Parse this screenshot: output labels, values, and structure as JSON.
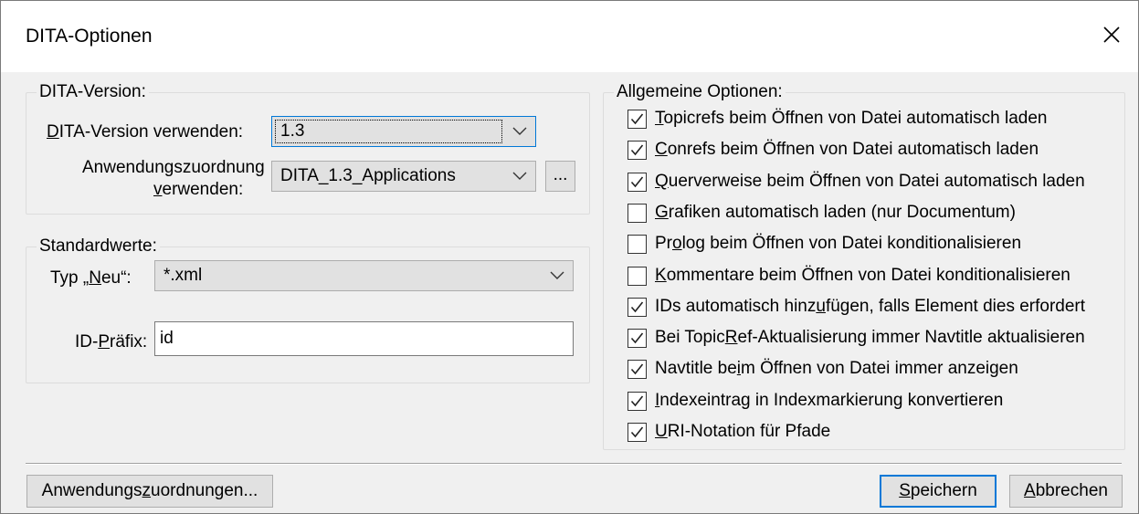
{
  "window": {
    "title": "DITA-Optionen"
  },
  "dita_version_group": {
    "legend": "DITA-Version:",
    "version_label": "DITA-Version verwenden:",
    "version_value": "1.3",
    "app_mapping_label_line1": "Anwendungszuordnung",
    "app_mapping_label_line2": "verwenden:",
    "app_mapping_value": "DITA_1.3_Applications",
    "browse_label": "..."
  },
  "defaults_group": {
    "legend": "Standardwerte:",
    "type_label": "Typ „Neu“:",
    "type_value": "*.xml",
    "id_prefix_label": "ID-Präfix:",
    "id_prefix_value": "id"
  },
  "general_options": {
    "legend": "Allgemeine Optionen:",
    "items": [
      {
        "label": "Topicrefs beim Öffnen von Datei automatisch laden",
        "checked": true
      },
      {
        "label": "Conrefs beim Öffnen von Datei automatisch laden",
        "checked": true
      },
      {
        "label": "Querverweise beim Öffnen von Datei automatisch laden",
        "checked": true
      },
      {
        "label": "Grafiken automatisch laden (nur Documentum)",
        "checked": false
      },
      {
        "label": "Prolog beim Öffnen von Datei konditionalisieren",
        "checked": false
      },
      {
        "label": "Kommentare beim Öffnen von Datei konditionalisieren",
        "checked": false
      },
      {
        "label": "IDs automatisch hinzufügen, falls Element dies erfordert",
        "checked": true
      },
      {
        "label": "Bei TopicRef-Aktualisierung immer Navtitle aktualisieren",
        "checked": true
      },
      {
        "label": "Navtitle beim Öffnen von Datei immer anzeigen",
        "checked": true
      },
      {
        "label": "Indexeintrag in Indexmarkierung konvertieren",
        "checked": true
      },
      {
        "label": "URI-Notation für Pfade",
        "checked": true
      }
    ]
  },
  "footer": {
    "app_mappings_button": "Anwendungszuordnungen...",
    "save_button": "Speichern",
    "cancel_button": "Abbrechen"
  },
  "icons": {
    "close": "close-icon",
    "dropdown": "chevron-down-icon",
    "check": "checkmark-icon"
  },
  "colors": {
    "accent": "#0078d7",
    "dialog_bg": "#f0f0f0",
    "button_bg": "#e1e1e1"
  }
}
